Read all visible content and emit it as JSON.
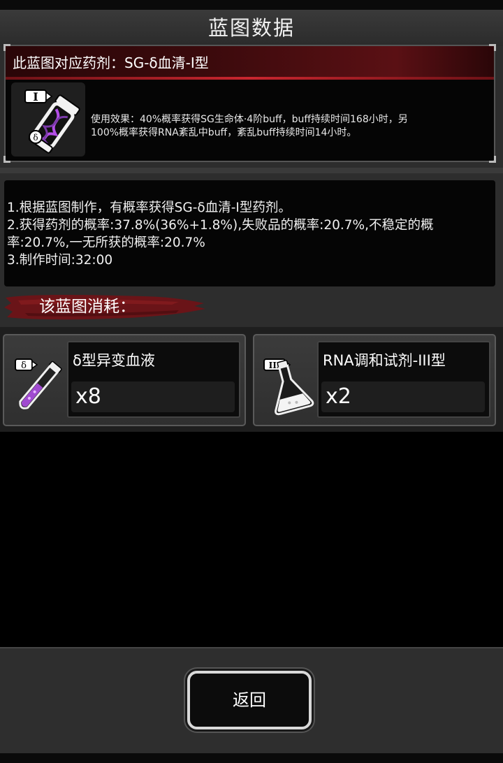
{
  "header": {
    "title": "蓝图数据"
  },
  "serum": {
    "title": "此蓝图对应药剂：SG-δ血清-I型",
    "icon_badge": "I",
    "icon": "serum-vial-icon",
    "description_line1": "使用效果：40%概率获得SG生命体·4阶buff，buff持续时间168小时，另",
    "description_line2": "100%概率获得RNA紊乱中buff，紊乱buff持续时间14小时。"
  },
  "info": {
    "line1": "1.根据蓝图制作，有概率获得SG-δ血清-I型药剂。",
    "line2": "2.获得药剂的概率:37.8%(36%+1.8%),失败品的概率:20.7%,不稳定的概",
    "line3": "率:20.7%,一无所获的概率:20.7%",
    "line4": "3.制作时间:32:00"
  },
  "consume": {
    "heading": "该蓝图消耗：",
    "materials": [
      {
        "name": "δ型异变血液",
        "qty": "x8",
        "badge": "δ",
        "icon": "test-tube-icon"
      },
      {
        "name": "RNA调和试剂-III型",
        "qty": "x2",
        "badge": "III",
        "icon": "flask-icon"
      }
    ]
  },
  "footer": {
    "back_label": "返回"
  },
  "colors": {
    "accent_red": "#c8262e",
    "vial_purple": "#a04ad0"
  }
}
